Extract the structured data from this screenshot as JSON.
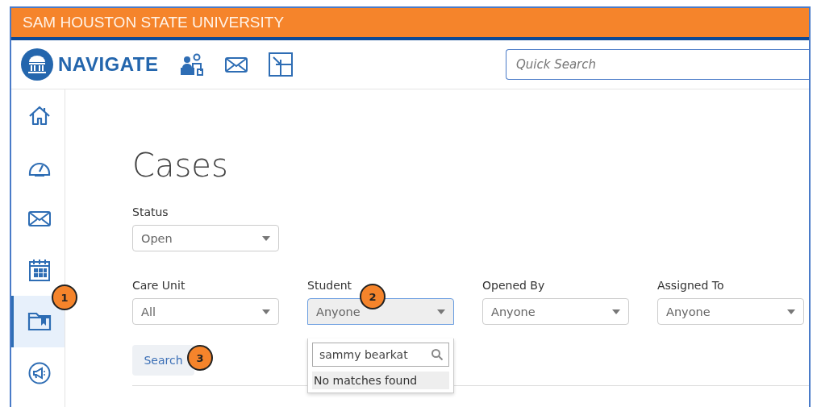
{
  "header": {
    "title": "SAM HOUSTON STATE UNIVERSITY"
  },
  "nav": {
    "brand": "NAVIGATE",
    "tools": [
      {
        "kind": "people"
      },
      {
        "kind": "mail"
      },
      {
        "kind": "resize"
      }
    ],
    "quick_search": {
      "placeholder": "Quick Search"
    }
  },
  "sidebar": {
    "items": [
      {
        "kind": "home",
        "selected": false
      },
      {
        "kind": "gauge",
        "selected": false
      },
      {
        "kind": "mail",
        "selected": false
      },
      {
        "kind": "calendar",
        "selected": false
      },
      {
        "kind": "folder",
        "selected": true
      },
      {
        "kind": "megaphone",
        "selected": false
      }
    ]
  },
  "page": {
    "title": "Cases",
    "status": {
      "label": "Status",
      "value": "Open",
      "open": false
    },
    "filters": [
      {
        "label": "Care Unit",
        "value": "All",
        "open": false
      },
      {
        "label": "Student",
        "value": "Anyone",
        "open": true,
        "dropdown": {
          "search_value": "sammy bearkat",
          "message": "No matches found"
        }
      },
      {
        "label": "Opened By",
        "value": "Anyone",
        "open": false
      },
      {
        "label": "Assigned To",
        "value": "Anyone",
        "open": false
      }
    ],
    "search_button": "Search"
  },
  "callouts": [
    "1",
    "2",
    "3"
  ]
}
